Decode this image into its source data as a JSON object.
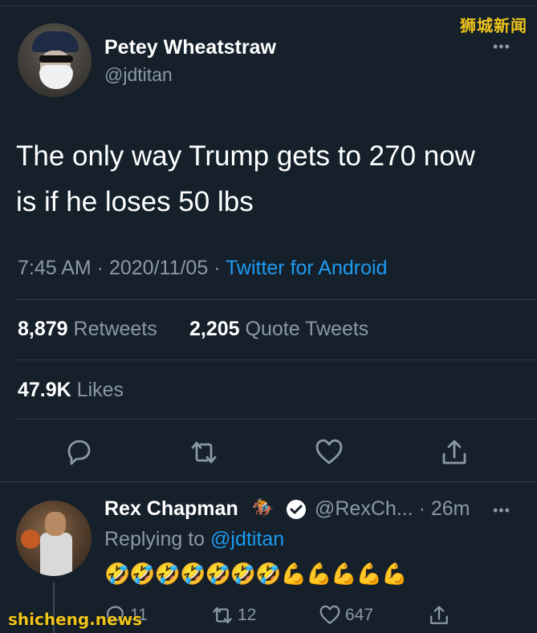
{
  "watermarks": {
    "top": "狮城新闻",
    "bottom": "shicheng.news"
  },
  "tweet": {
    "author_name": "Petey Wheatstraw",
    "author_handle": "@jdtitan",
    "more_label": "•••",
    "text_line1": "The only way Trump gets to 270 now",
    "text_line2": "is if he loses 50 lbs",
    "time": "7:45 AM",
    "separator": " · ",
    "date": "2020/11/05",
    "source": "Twitter for Android",
    "retweets_count": "8,879",
    "retweets_label": "Retweets",
    "quote_count": "2,205",
    "quote_label": "Quote Tweets",
    "likes_count": "47.9K",
    "likes_label": "Likes",
    "actions": [
      "reply-icon",
      "retweet-icon",
      "like-icon",
      "share-icon"
    ]
  },
  "reply": {
    "author_name": "Rex Chapman",
    "badge_emoji": "🏇",
    "verified_icon": "verified-badge-icon",
    "author_handle": "@RexCh...",
    "age": "· 26m",
    "more_label": "•••",
    "replying_prefix": "Replying to",
    "replying_to": "@jdtitan",
    "text": "🤣🤣🤣🤣🤣🤣🤣💪💪💪💪💪",
    "reply_count": "11",
    "retweet_count": "12",
    "like_count": "647"
  },
  "colors": {
    "background": "#15202b",
    "text": "#ffffff",
    "secondary": "#8b98a5",
    "accent": "#1d9bf0",
    "watermark": "#f0c419"
  }
}
